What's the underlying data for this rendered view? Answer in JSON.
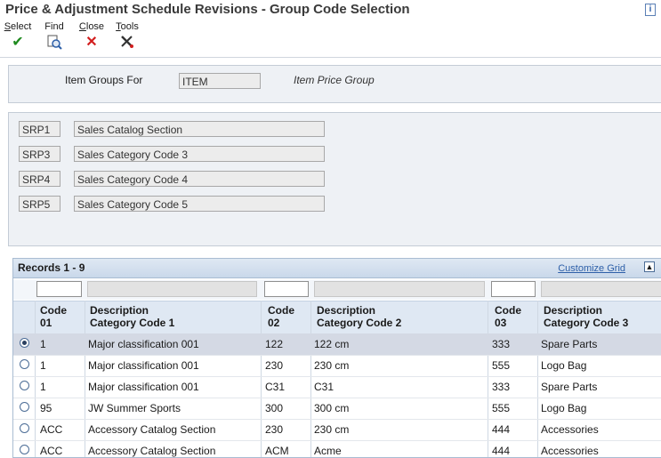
{
  "window": {
    "title": "Price & Adjustment Schedule Revisions - Group Code Selection"
  },
  "toolbar": {
    "select": {
      "accel": "S",
      "rest": "elect"
    },
    "find": {
      "label": "Find"
    },
    "close": {
      "accel": "C",
      "rest": "lose"
    },
    "tools": {
      "accel": "T",
      "rest": "ools"
    }
  },
  "header": {
    "item_groups_label": "Item Groups For",
    "item_groups_value": "ITEM",
    "item_price_group_label": "Item Price Group"
  },
  "categories": [
    {
      "code": "SRP1",
      "description": "Sales Catalog Section"
    },
    {
      "code": "SRP3",
      "description": "Sales Category Code 3"
    },
    {
      "code": "SRP4",
      "description": "Sales Category Code 4"
    },
    {
      "code": "SRP5",
      "description": "Sales Category Code 5"
    }
  ],
  "grid": {
    "records_label": "Records 1 - 9",
    "customize_label": "Customize Grid",
    "columns": [
      {
        "line1": "Code",
        "line2": "01"
      },
      {
        "line1": "Description",
        "line2": "Category Code 1"
      },
      {
        "line1": "Code",
        "line2": "02"
      },
      {
        "line1": "Description",
        "line2": "Category Code 2"
      },
      {
        "line1": "Code",
        "line2": "03"
      },
      {
        "line1": "Description",
        "line2": "Category Code 3"
      }
    ],
    "rows": [
      {
        "c1": "1",
        "d1": "Major classification 001",
        "c2": "122",
        "d2": "122 cm",
        "c3": "333",
        "d3": "Spare Parts",
        "selected": true
      },
      {
        "c1": "1",
        "d1": "Major classification 001",
        "c2": "230",
        "d2": "230 cm",
        "c3": "555",
        "d3": "Logo Bag"
      },
      {
        "c1": "1",
        "d1": "Major classification 001",
        "c2": "C31",
        "d2": "C31",
        "c3": "333",
        "d3": "Spare Parts"
      },
      {
        "c1": "95",
        "d1": "JW Summer Sports",
        "c2": "300",
        "d2": "300 cm",
        "c3": "555",
        "d3": "Logo Bag"
      },
      {
        "c1": "ACC",
        "d1": "Accessory Catalog Section",
        "c2": "230",
        "d2": "230 cm",
        "c3": "444",
        "d3": "Accessories"
      },
      {
        "c1": "ACC",
        "d1": "Accessory Catalog Section",
        "c2": "ACM",
        "d2": "Acme",
        "c3": "444",
        "d3": "Accessories"
      }
    ]
  },
  "colors": {
    "accent_link": "#2d5fa8",
    "grid_header": "#dfe8f3",
    "selected_row": "#d4d9e4"
  }
}
